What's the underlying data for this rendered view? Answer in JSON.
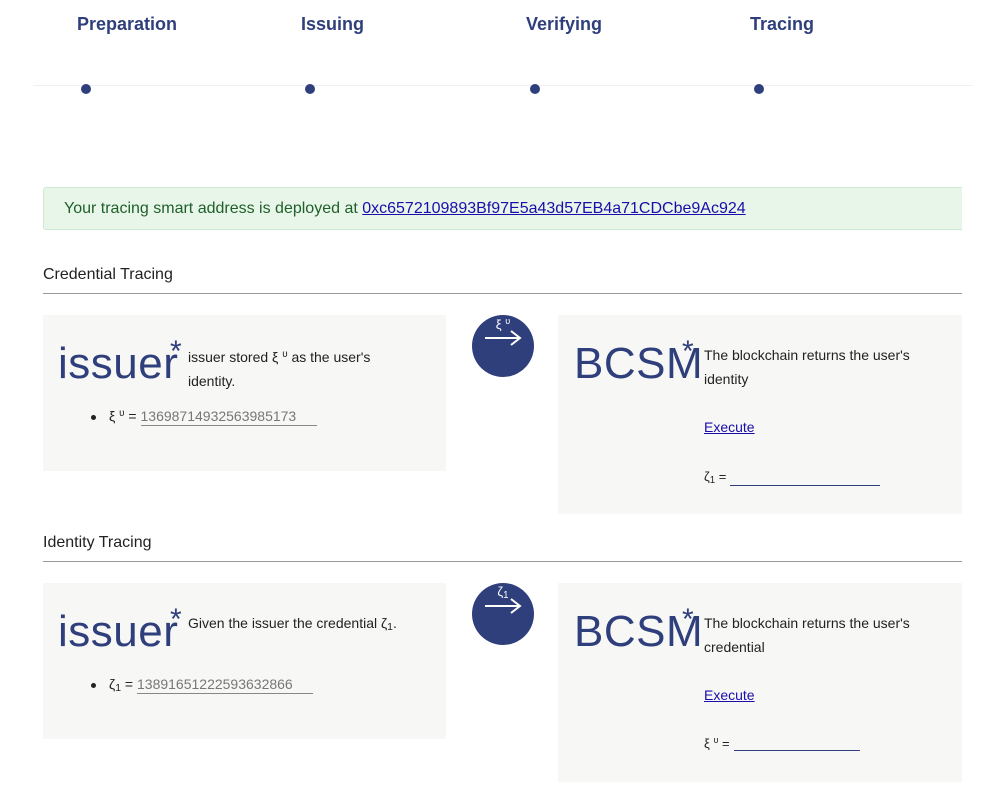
{
  "steps": [
    {
      "label": "Preparation"
    },
    {
      "label": "Issuing"
    },
    {
      "label": "Verifying"
    },
    {
      "label": "Tracing"
    }
  ],
  "alert": {
    "text": "Your tracing smart address is deployed at ",
    "address": "0xc6572109893Bf97E5a43d57EB4a71CDCbe9Ac924"
  },
  "credential_tracing": {
    "title": "Credential Tracing",
    "issuer": {
      "word": "issuer",
      "star": "*",
      "desc_before": "issuer stored ξ",
      "desc_sup": "υ",
      "desc_after": " as the user's identity.",
      "bullet_symbol": "ξ",
      "bullet_sup": "υ",
      "bullet_eq": " = ",
      "value": "13698714932563985173"
    },
    "arrow": {
      "symbol": "ξ",
      "sup": "υ"
    },
    "bcsm": {
      "word": "BCSM",
      "star": "*",
      "desc": "The blockchain returns the user's identity",
      "execute": "Execute",
      "result_symbol": "ζ",
      "result_sub": "1",
      "result_eq": " ="
    }
  },
  "identity_tracing": {
    "title": "Identity Tracing",
    "issuer": {
      "word": "issuer",
      "star": "*",
      "desc_before": "Given the issuer the credential ζ",
      "desc_sub": "1",
      "desc_after": ".",
      "bullet_symbol": "ζ",
      "bullet_sub": "1",
      "bullet_eq": " = ",
      "value": "13891651222593632866"
    },
    "arrow": {
      "symbol": "ζ",
      "sub": "1"
    },
    "bcsm": {
      "word": "BCSM",
      "star": "*",
      "desc": "The blockchain returns the user's credential",
      "execute": "Execute",
      "result_symbol": "ξ",
      "result_sup": "υ",
      "result_eq": " ="
    }
  },
  "colors": {
    "primary": "#2f3f7c",
    "alert_bg": "#e8f6e9",
    "alert_text": "#1f5f2a",
    "link": "#1a0dab",
    "panel_bg": "#f7f7f5"
  }
}
